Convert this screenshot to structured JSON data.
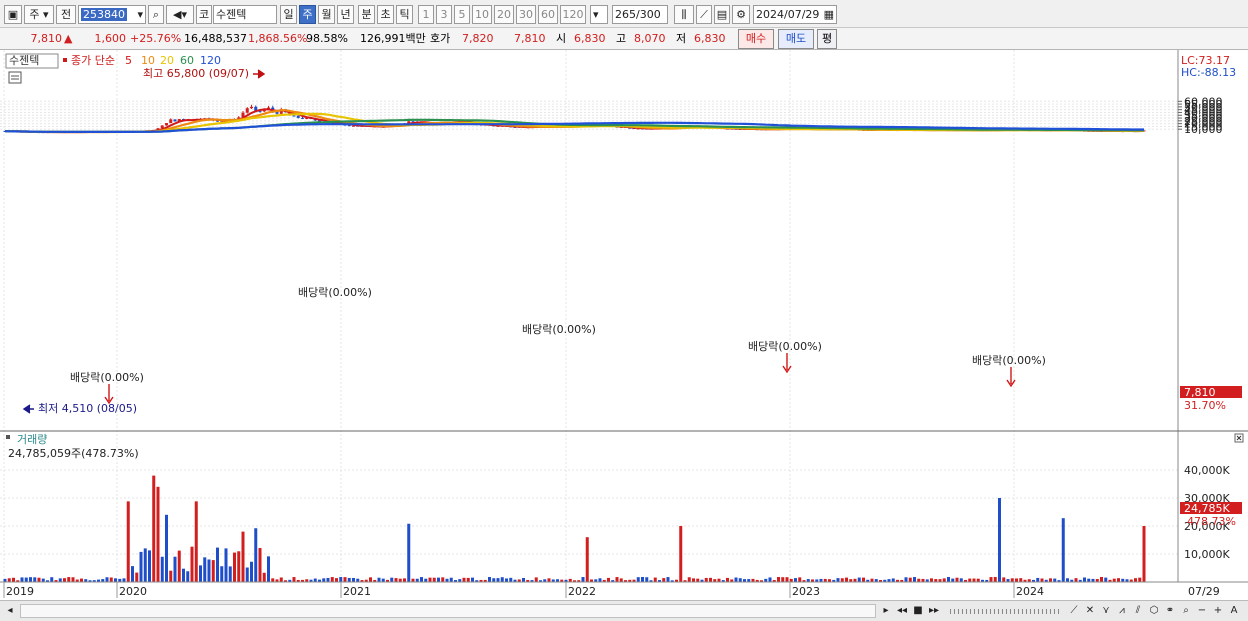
{
  "toolbar": {
    "market": "주",
    "prev_label": "전",
    "code": "253840",
    "exch_label": "코",
    "name": "수젠텍",
    "periods": [
      "일",
      "주",
      "월",
      "년",
      "분",
      "초",
      "틱"
    ],
    "active_period": "주",
    "intervals": [
      "1",
      "3",
      "5",
      "10",
      "20",
      "30",
      "60",
      "120"
    ],
    "count": "265",
    "count_total": "/300",
    "date": "2024/07/29"
  },
  "quote": {
    "price": "7,810",
    "arrow": "▲",
    "change": "1,600",
    "change_pct": "+25.76%",
    "volume": "16,488,537",
    "volume_ratio": "1,868.56%",
    "turnover": "98.58%",
    "amount": "126,991백만",
    "hoga_label": "호가",
    "bid": "7,820",
    "ask": "7,810",
    "open_label": "시",
    "open": "6,830",
    "high_label": "고",
    "high": "8,070",
    "low_label": "저",
    "low": "6,830",
    "buy_label": "매수",
    "sell_label": "매도",
    "eval_label": "평"
  },
  "legend": {
    "stock_name": "수젠텍",
    "ma_title": "종가 단순",
    "ma_periods": [
      "5",
      "10",
      "20",
      "60",
      "120"
    ],
    "ma_colors": [
      "#d01818",
      "#ee8a10",
      "#e8c400",
      "#2a9050",
      "#2050d8"
    ]
  },
  "lc_hc": {
    "lc": "LC:73.17",
    "hc": "HC:-88.13"
  },
  "annotations": {
    "high": "최고 65,800 (09/07)",
    "low": "최저 4,510 (08/05)",
    "dividends": [
      "배당락(0.00%)",
      "배당락(0.00%)",
      "배당락(0.00%)",
      "배당락(0.00%)",
      "배당락(0.00%)"
    ]
  },
  "price_axis": [
    "60,000",
    "55,000",
    "50,000",
    "45,000",
    "40,000",
    "35,000",
    "30,000",
    "25,000",
    "20,000",
    "15,000",
    "10,000"
  ],
  "price_tag": {
    "price": "7,810",
    "pct": "31.70%"
  },
  "volume_panel": {
    "title": "거래량",
    "info": "24,785,059주(478.73%)",
    "axis": [
      "40,000K",
      "30,000K",
      "20,000K",
      "10,000K"
    ],
    "tag_value": "24,785K",
    "tag_pct": "478.73%"
  },
  "x_axis": [
    "2019",
    "2020",
    "2021",
    "2022",
    "2023",
    "2024"
  ],
  "x_right_label": "07/29",
  "colors": {
    "up": "#d21e1e",
    "down": "#1e4fc8"
  }
}
